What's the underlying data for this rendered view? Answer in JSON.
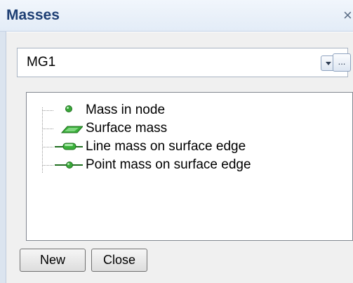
{
  "window": {
    "title": "Masses",
    "close_label": "×"
  },
  "mass_group": {
    "selected": "MG1",
    "browse_label": "..."
  },
  "tree": {
    "items": [
      {
        "label": "Mass in node",
        "icon": "node-mass-icon"
      },
      {
        "label": "Surface mass",
        "icon": "surface-mass-icon"
      },
      {
        "label": "Line mass on surface edge",
        "icon": "line-mass-icon"
      },
      {
        "label": "Point mass on surface edge",
        "icon": "point-mass-icon"
      }
    ]
  },
  "buttons": {
    "new_label": "New",
    "close_label": "Close"
  },
  "colors": {
    "title_text": "#1e3f74",
    "icon_green": "#2e9e2e"
  }
}
